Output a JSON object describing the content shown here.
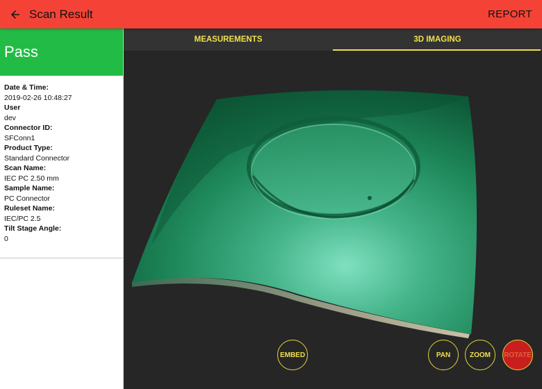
{
  "appbar": {
    "title": "Scan Result",
    "report_label": "REPORT"
  },
  "result": {
    "status": "Pass"
  },
  "details": [
    {
      "label": "Date & Time:",
      "value": "2019-02-26 10:48:27"
    },
    {
      "label": "User",
      "value": "dev"
    },
    {
      "label": "Connector ID:",
      "value": "SFConn1"
    },
    {
      "label": "Product Type:",
      "value": "Standard Connector"
    },
    {
      "label": "Scan Name:",
      "value": "IEC PC 2.50 mm"
    },
    {
      "label": "Sample Name:",
      "value": "PC Connector"
    },
    {
      "label": "Ruleset Name:",
      "value": "IEC/PC 2.5"
    },
    {
      "label": "Tilt Stage Angle:",
      "value": "0"
    }
  ],
  "tabs": [
    {
      "label": "MEASUREMENTS",
      "active": false
    },
    {
      "label": "3D IMAGING",
      "active": true
    }
  ],
  "controls": {
    "embed": "EMBED",
    "pan": "PAN",
    "zoom": "ZOOM",
    "rotate": "ROTATE",
    "active": "rotate"
  },
  "colors": {
    "appbar": "#f44336",
    "status": "#22bb45",
    "accent": "#f2e04a",
    "active_button": "#c81e1e"
  },
  "icons": {
    "back": "arrow-left-icon"
  }
}
